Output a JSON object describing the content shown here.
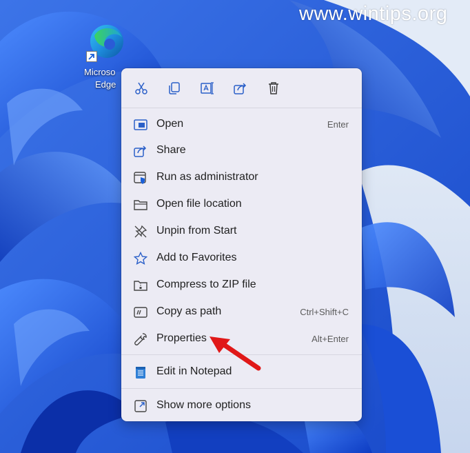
{
  "watermark": "www.wintips.org",
  "desktop_icon": {
    "line1": "Microso",
    "line2": "Edge"
  },
  "toolbar": [
    "cut-icon",
    "copy-icon",
    "rename-icon",
    "share-icon",
    "delete-icon"
  ],
  "menu": {
    "items": [
      {
        "label": "Open",
        "shortcut": "Enter",
        "icon": "open-icon"
      },
      {
        "label": "Share",
        "shortcut": "",
        "icon": "share-icon"
      },
      {
        "label": "Run as administrator",
        "shortcut": "",
        "icon": "shield-icon"
      },
      {
        "label": "Open file location",
        "shortcut": "",
        "icon": "folder-icon"
      },
      {
        "label": "Unpin from Start",
        "shortcut": "",
        "icon": "unpin-icon"
      },
      {
        "label": "Add to Favorites",
        "shortcut": "",
        "icon": "star-icon"
      },
      {
        "label": "Compress to ZIP file",
        "shortcut": "",
        "icon": "zip-icon"
      },
      {
        "label": "Copy as path",
        "shortcut": "Ctrl+Shift+C",
        "icon": "copy-path-icon"
      },
      {
        "label": "Properties",
        "shortcut": "Alt+Enter",
        "icon": "wrench-icon"
      },
      {
        "label": "Edit in Notepad",
        "shortcut": "",
        "icon": "notepad-icon"
      },
      {
        "label": "Show more options",
        "shortcut": "",
        "icon": "more-options-icon"
      }
    ]
  },
  "colors": {
    "accent": "#1a5fd8",
    "arrow": "#e01818"
  }
}
